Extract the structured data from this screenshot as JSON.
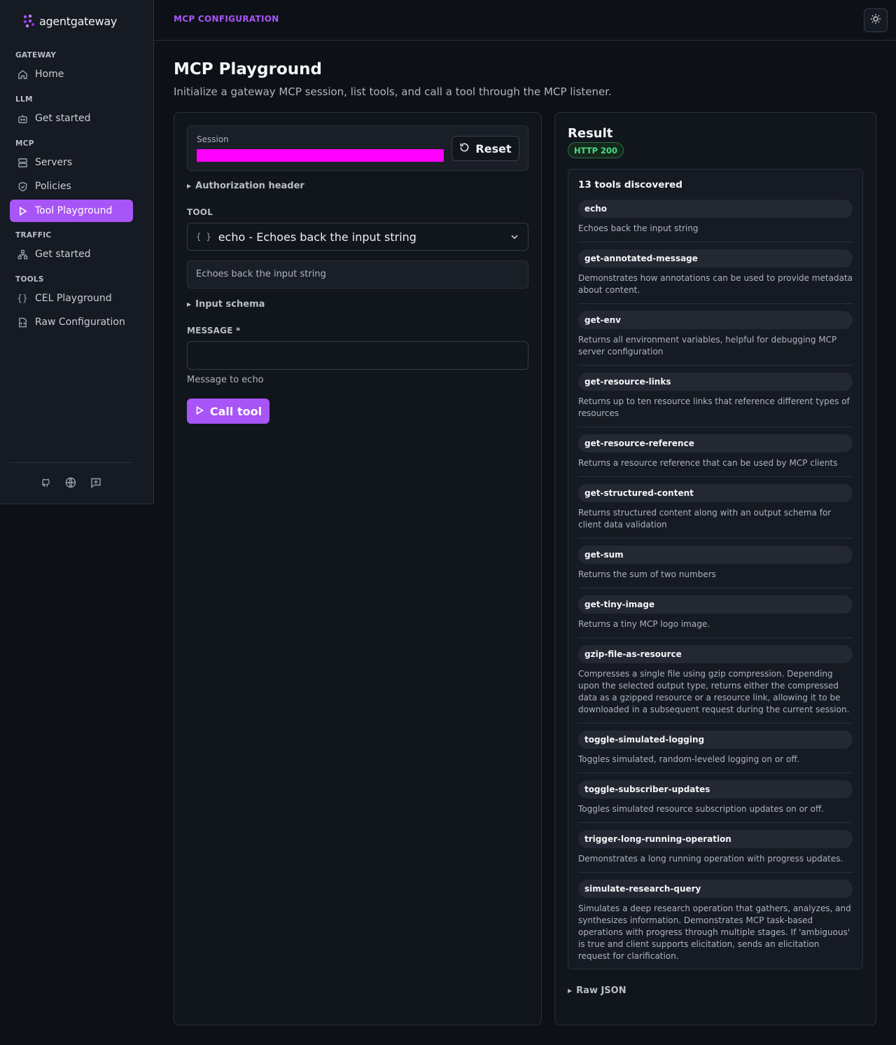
{
  "sidebar": {
    "logo_text": "agentgateway",
    "groups": {
      "gateway": "GATEWAY",
      "llm": "LLM",
      "mcp": "MCP",
      "traffic": "TRAFFIC",
      "tools": "TOOLS"
    },
    "items": {
      "home": "Home",
      "llm_get_started": "Get started",
      "servers": "Servers",
      "policies": "Policies",
      "tool_playground": "Tool Playground",
      "traffic_get_started": "Get started",
      "cel_playground": "CEL Playground",
      "raw_configuration": "Raw Configuration"
    },
    "active_item": "Tool Playground"
  },
  "header": {
    "breadcrumb": "MCP CONFIGURATION"
  },
  "page": {
    "title": "MCP Playground",
    "subtitle": "Initialize a gateway MCP session, list tools, and call a tool through the MCP listener."
  },
  "session": {
    "label": "Session",
    "reset_label": "Reset"
  },
  "auth_header_label": "Authorization header",
  "tool_field": {
    "label": "TOOL",
    "braces": "{ }",
    "selected": "echo - Echoes back the input string",
    "description": "Echoes back the input string"
  },
  "input_schema_label": "Input schema",
  "message_field": {
    "label": "MESSAGE *",
    "value": "",
    "help": "Message to echo"
  },
  "call_tool_label": "Call tool",
  "result": {
    "title": "Result",
    "status": "HTTP 200",
    "count_label": "13 tools discovered",
    "raw_json_label": "Raw JSON",
    "tools": [
      {
        "name": "echo",
        "description": "Echoes back the input string"
      },
      {
        "name": "get-annotated-message",
        "description": "Demonstrates how annotations can be used to provide metadata about content."
      },
      {
        "name": "get-env",
        "description": "Returns all environment variables, helpful for debugging MCP server configuration"
      },
      {
        "name": "get-resource-links",
        "description": "Returns up to ten resource links that reference different types of resources"
      },
      {
        "name": "get-resource-reference",
        "description": "Returns a resource reference that can be used by MCP clients"
      },
      {
        "name": "get-structured-content",
        "description": "Returns structured content along with an output schema for client data validation"
      },
      {
        "name": "get-sum",
        "description": "Returns the sum of two numbers"
      },
      {
        "name": "get-tiny-image",
        "description": "Returns a tiny MCP logo image."
      },
      {
        "name": "gzip-file-as-resource",
        "description": "Compresses a single file using gzip compression. Depending upon the selected output type, returns either the compressed data as a gzipped resource or a resource link, allowing it to be downloaded in a subsequent request during the current session."
      },
      {
        "name": "toggle-simulated-logging",
        "description": "Toggles simulated, random-leveled logging on or off."
      },
      {
        "name": "toggle-subscriber-updates",
        "description": "Toggles simulated resource subscription updates on or off."
      },
      {
        "name": "trigger-long-running-operation",
        "description": "Demonstrates a long running operation with progress updates."
      },
      {
        "name": "simulate-research-query",
        "description": "Simulates a deep research operation that gathers, analyzes, and synthesizes information. Demonstrates MCP task-based operations with progress through multiple stages. If 'ambiguous' is true and client supports elicitation, sends an elicitation request for clarification."
      }
    ]
  },
  "colors": {
    "accent": "#a855f7",
    "background": "#0d1117",
    "success": "#4ade80",
    "session_redaction": "#ff00ff"
  }
}
